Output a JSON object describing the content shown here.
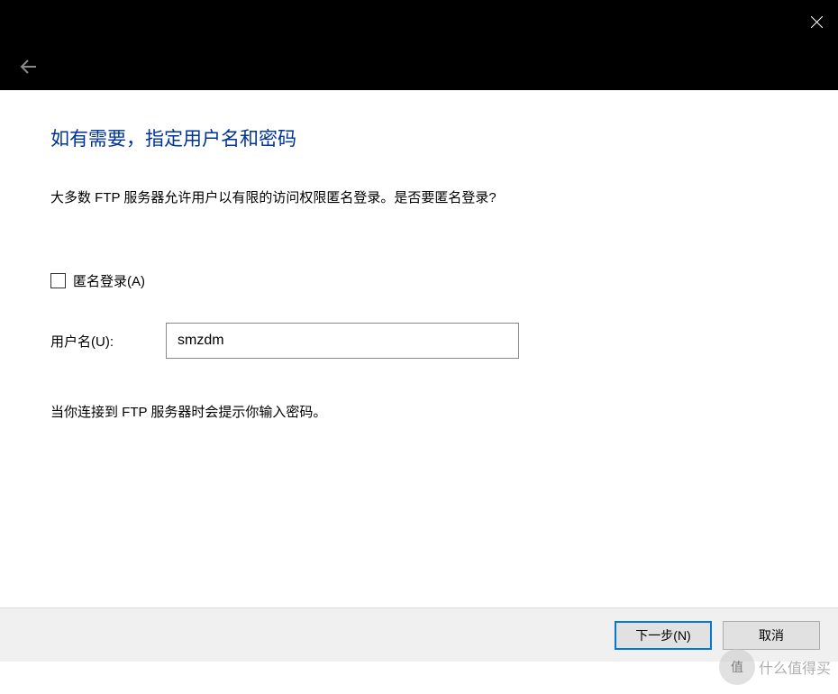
{
  "heading": "如有需要，指定用户名和密码",
  "description": "大多数 FTP 服务器允许用户以有限的访问权限匿名登录。是否要匿名登录?",
  "checkbox": {
    "label": "匿名登录(A)",
    "checked": false
  },
  "username": {
    "label": "用户名(U):",
    "value": "smzdm"
  },
  "hint": "当你连接到 FTP 服务器时会提示你输入密码。",
  "buttons": {
    "next": "下一步(N)",
    "cancel": "取消"
  },
  "watermark": {
    "badge": "值",
    "text": "什么值得买"
  }
}
